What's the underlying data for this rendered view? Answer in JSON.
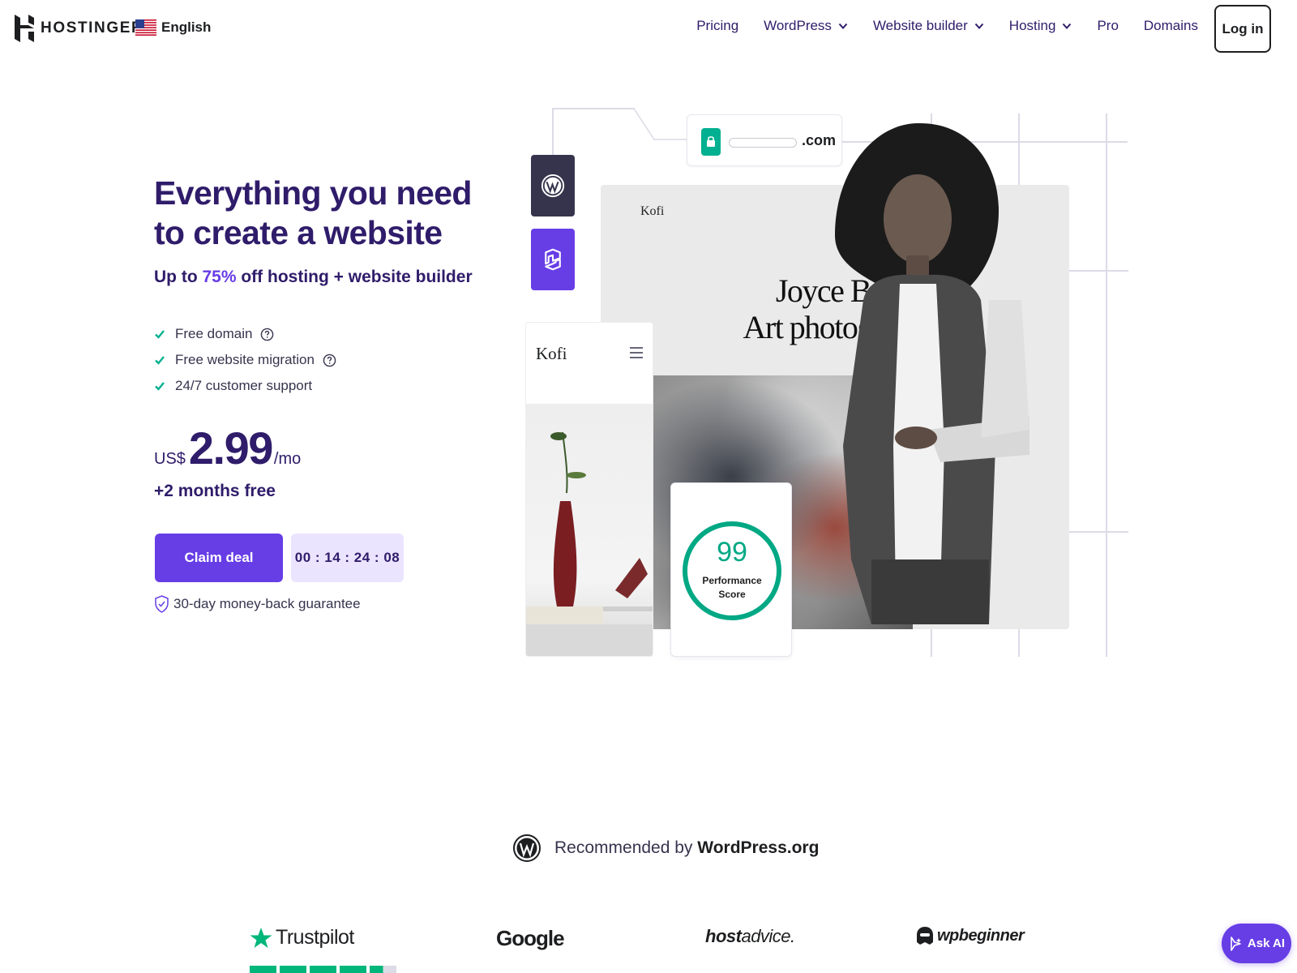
{
  "header": {
    "brand": "HOSTINGER",
    "language": "English",
    "nav": [
      {
        "label": "Pricing",
        "dropdown": false
      },
      {
        "label": "WordPress",
        "dropdown": true
      },
      {
        "label": "Website builder",
        "dropdown": true
      },
      {
        "label": "Hosting",
        "dropdown": true
      },
      {
        "label": "Pro",
        "dropdown": false
      },
      {
        "label": "Domains",
        "dropdown": false
      }
    ],
    "login_label": "Log in"
  },
  "hero": {
    "title": "Everything you need to create a website",
    "subtitle_prefix": "Up to ",
    "subtitle_highlight": "75%",
    "subtitle_suffix": " off hosting + website builder",
    "features": [
      {
        "label": "Free domain",
        "help": true
      },
      {
        "label": "Free website migration",
        "help": true
      },
      {
        "label": "24/7 customer support",
        "help": false
      }
    ],
    "price_currency": "US$",
    "price_value": "2.99",
    "price_period": "/mo",
    "bonus": "+2 months free",
    "cta_label": "Claim deal",
    "timer": "00 : 14 : 24 : 08",
    "guarantee": "30-day money-back guarantee"
  },
  "illustration": {
    "url_tld": ".com",
    "site_brand": "Kofi",
    "site_headline_line1": "Joyce Beale,",
    "site_headline_line2": "Art photograph",
    "mobile_brand": "Kofi",
    "score_value": "99",
    "score_label_line1": "Performance",
    "score_label_line2": "Score"
  },
  "recommended": {
    "prefix": "Recommended by ",
    "org": "WordPress.org"
  },
  "reviews": [
    {
      "name": "Trustpilot",
      "icon": "trustpilot-star-icon"
    },
    {
      "name": "Google",
      "icon": "google-logo"
    },
    {
      "name_prefix": "host",
      "name_suffix": "advice.",
      "icon": "hostadvice-logo"
    },
    {
      "name": "wpbeginner",
      "icon": "wpbeginner-icon"
    }
  ],
  "ask_ai_label": "Ask AI",
  "colors": {
    "brand_purple": "#673de6",
    "heading_navy": "#2f1c6a",
    "teal": "#00b090",
    "trustpilot_green": "#00b67a"
  }
}
